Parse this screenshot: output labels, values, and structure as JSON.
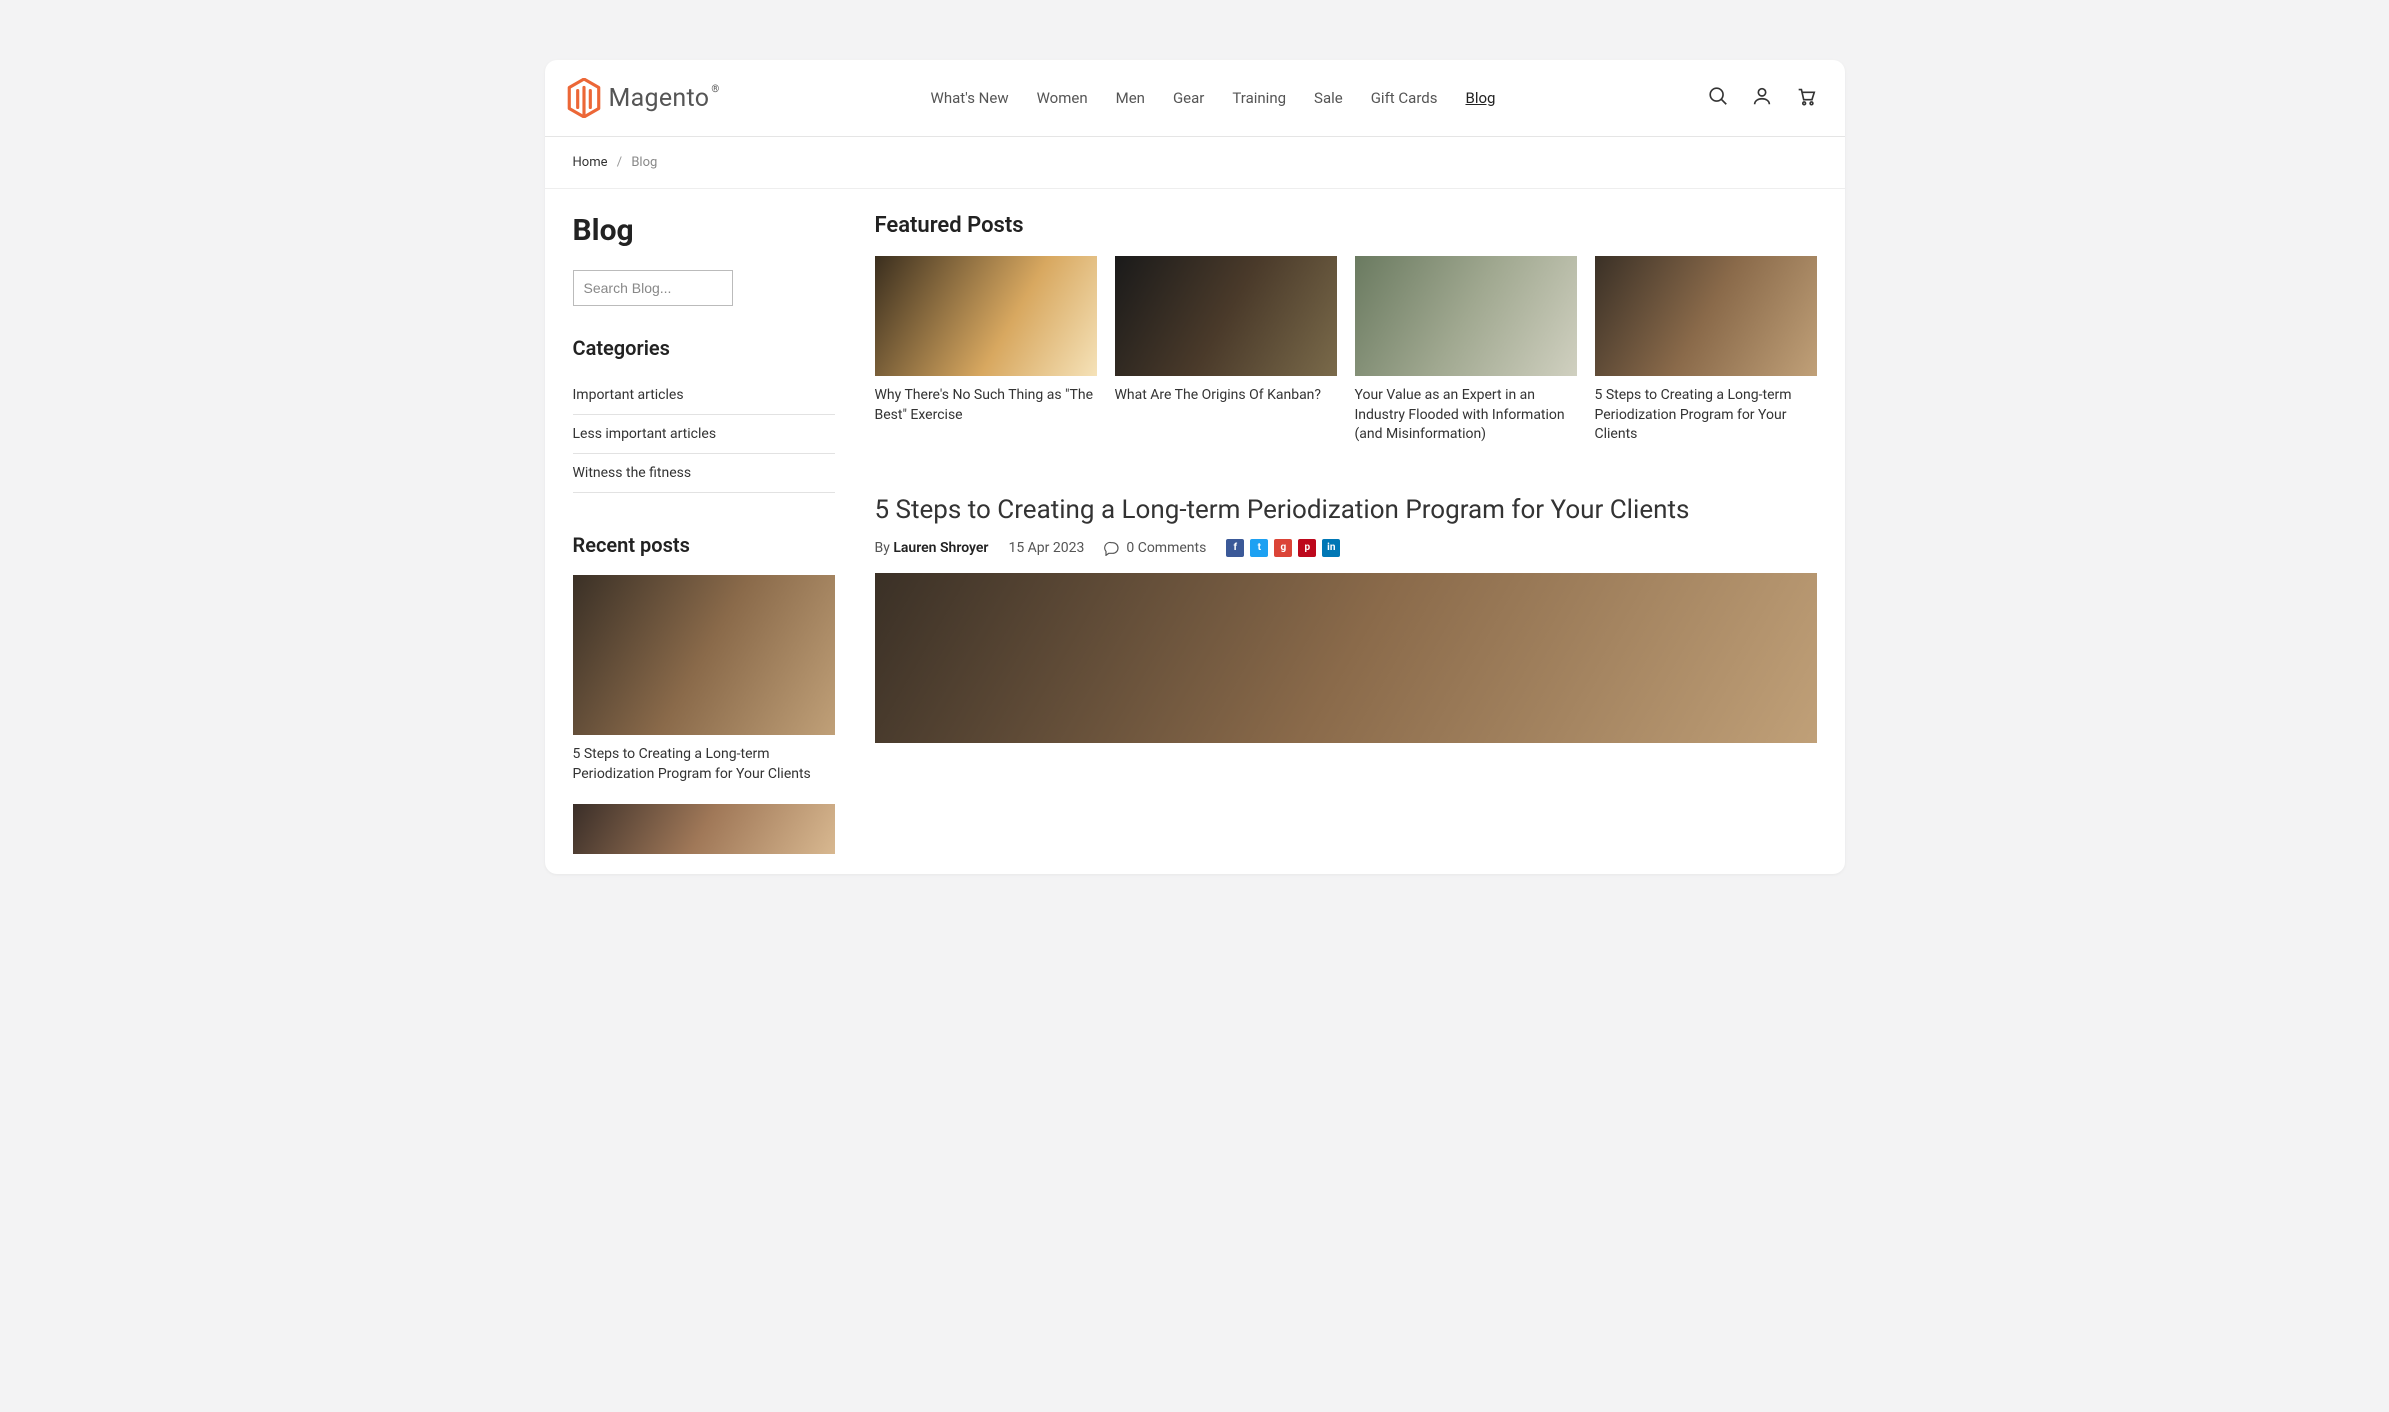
{
  "brand": {
    "name": "Magento",
    "trademark": "®"
  },
  "nav": {
    "items": [
      {
        "label": "What's New"
      },
      {
        "label": "Women"
      },
      {
        "label": "Men"
      },
      {
        "label": "Gear"
      },
      {
        "label": "Training"
      },
      {
        "label": "Sale"
      },
      {
        "label": "Gift Cards"
      },
      {
        "label": "Blog",
        "active": true
      }
    ]
  },
  "breadcrumb": {
    "home": "Home",
    "current": "Blog"
  },
  "page": {
    "title": "Blog"
  },
  "search": {
    "placeholder": "Search Blog..."
  },
  "sidebar": {
    "categories_heading": "Categories",
    "categories": [
      {
        "label": "Important articles"
      },
      {
        "label": "Less important articles"
      },
      {
        "label": "Witness the fitness"
      }
    ],
    "recent_heading": "Recent posts",
    "recent": [
      {
        "title": "5 Steps to Creating a Long-term Periodization Program for Your Clients",
        "img": "trainer"
      },
      {
        "title": "",
        "img": "smile"
      }
    ]
  },
  "featured": {
    "heading": "Featured Posts",
    "items": [
      {
        "title": "Why There's No Such Thing as \"The Best\" Exercise",
        "img": "sunset"
      },
      {
        "title": "What Are The Origins Of Kanban?",
        "img": "gym-dark"
      },
      {
        "title": "Your Value as an Expert in an Industry Flooded with Information (and Misinformation)",
        "img": "phone"
      },
      {
        "title": "5 Steps to Creating a Long-term Periodization Program for Your Clients",
        "img": "trainer"
      }
    ]
  },
  "article": {
    "title": "5 Steps to Creating a Long-term Periodization Program for Your Clients",
    "by_label": "By",
    "author": "Lauren Shroyer",
    "date": "15 Apr 2023",
    "comments": "0 Comments"
  }
}
